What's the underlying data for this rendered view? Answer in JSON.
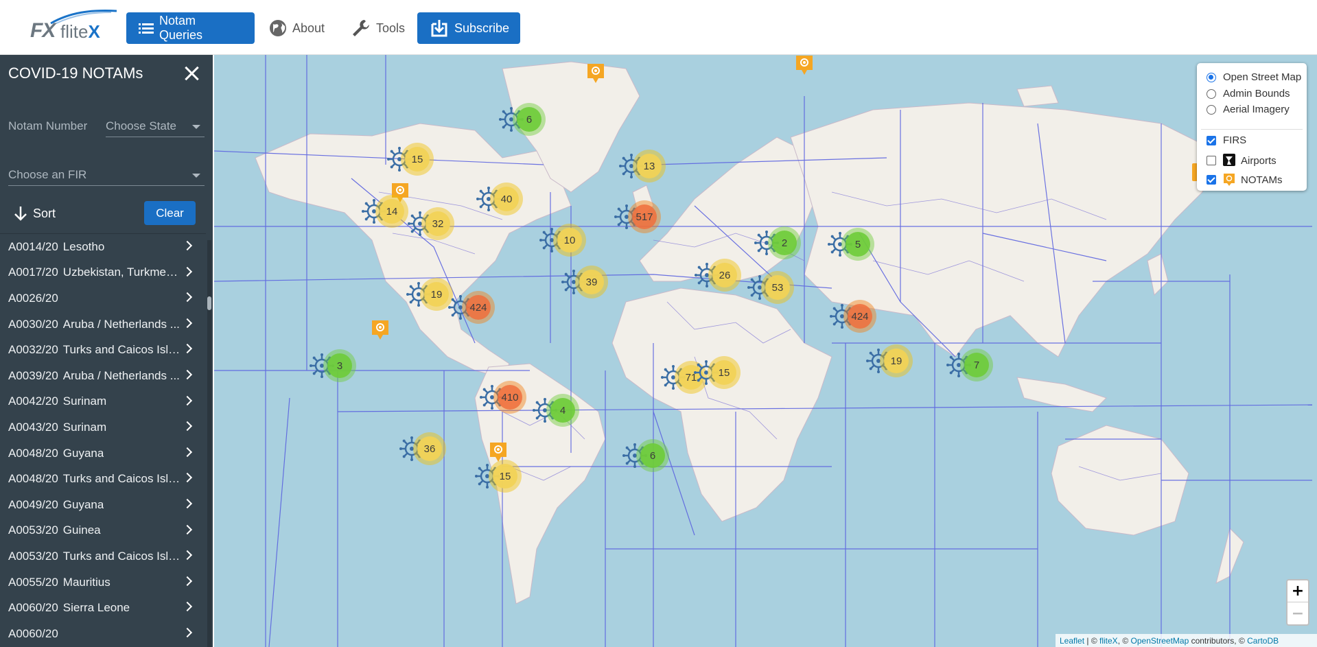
{
  "nav": {
    "logo_fx": "FX",
    "logo_flite": "flite",
    "logo_x": "X",
    "queries_label": "Notam Queries",
    "about_label": "About",
    "tools_label": "Tools",
    "subscribe_label": "Subscribe"
  },
  "sidebar": {
    "title": "COVID-19 NOTAMs",
    "notam_number_placeholder": "Notam Number",
    "state_placeholder": "Choose State",
    "fir_placeholder": "Choose an FIR",
    "sort_label": "Sort",
    "clear_label": "Clear",
    "items": [
      {
        "num": "A0014/20",
        "name": "Lesotho"
      },
      {
        "num": "A0017/20",
        "name": "Uzbekistan, Turkmeni..."
      },
      {
        "num": "A0026/20",
        "name": ""
      },
      {
        "num": "A0030/20",
        "name": "Aruba / Netherlands ..."
      },
      {
        "num": "A0032/20",
        "name": "Turks and Caicos Isla..."
      },
      {
        "num": "A0039/20",
        "name": "Aruba / Netherlands ..."
      },
      {
        "num": "A0042/20",
        "name": "Surinam"
      },
      {
        "num": "A0043/20",
        "name": "Surinam"
      },
      {
        "num": "A0048/20",
        "name": "Guyana"
      },
      {
        "num": "A0048/20",
        "name": "Turks and Caicos Isla..."
      },
      {
        "num": "A0049/20",
        "name": "Guyana"
      },
      {
        "num": "A0053/20",
        "name": "Guinea"
      },
      {
        "num": "A0053/20",
        "name": "Turks and Caicos Isla..."
      },
      {
        "num": "A0055/20",
        "name": "Mauritius"
      },
      {
        "num": "A0060/20",
        "name": "Sierra Leone"
      },
      {
        "num": "A0060/20",
        "name": ""
      }
    ]
  },
  "map": {
    "clusters": [
      {
        "count": "6",
        "level": "green"
      },
      {
        "count": "15",
        "level": "yellow"
      },
      {
        "count": "13",
        "level": "yellow"
      },
      {
        "count": "40",
        "level": "yellow"
      },
      {
        "count": "14",
        "level": "yellow"
      },
      {
        "count": "32",
        "level": "yellow"
      },
      {
        "count": "517",
        "level": "orange"
      },
      {
        "count": "10",
        "level": "yellow"
      },
      {
        "count": "2",
        "level": "green"
      },
      {
        "count": "5",
        "level": "green"
      },
      {
        "count": "19",
        "level": "yellow"
      },
      {
        "count": "39",
        "level": "yellow"
      },
      {
        "count": "26",
        "level": "yellow"
      },
      {
        "count": "53",
        "level": "yellow"
      },
      {
        "count": "424",
        "level": "orange"
      },
      {
        "count": "424",
        "level": "orange"
      },
      {
        "count": "3",
        "level": "green"
      },
      {
        "count": "19",
        "level": "yellow"
      },
      {
        "count": "7",
        "level": "green"
      },
      {
        "count": "71",
        "level": "yellow"
      },
      {
        "count": "15",
        "level": "yellow"
      },
      {
        "count": "410",
        "level": "orange"
      },
      {
        "count": "4",
        "level": "green"
      },
      {
        "count": "36",
        "level": "yellow"
      },
      {
        "count": "6",
        "level": "green"
      },
      {
        "count": "15",
        "level": "yellow"
      }
    ],
    "layer_control": {
      "base_layers": [
        {
          "label": "Open Street Map",
          "selected": true
        },
        {
          "label": "Admin Bounds",
          "selected": false
        },
        {
          "label": "Aerial Imagery",
          "selected": false
        }
      ],
      "overlays": [
        {
          "label": "FIRS",
          "checked": true
        },
        {
          "label": "Airports",
          "checked": false
        },
        {
          "label": "NOTAMs",
          "checked": true
        }
      ]
    },
    "zoom_in": "+",
    "zoom_out": "−",
    "attribution": {
      "leaflet": "Leaflet",
      "sep1": " | © ",
      "flitex": "fliteX",
      "sep2": ", © ",
      "osm": "OpenStreetMap",
      "sep3": " contributors, © ",
      "carto": "CartoDB"
    }
  },
  "colors": {
    "primary": "#1a6fc4",
    "sidebar_bg": "#34424c",
    "ocean": "#a9d0df",
    "land": "#f2efe9",
    "fir_lines": "#5b63e0",
    "cluster_green": "#6ecc39",
    "cluster_yellow": "#f1d357",
    "cluster_orange": "#f06e3c"
  }
}
